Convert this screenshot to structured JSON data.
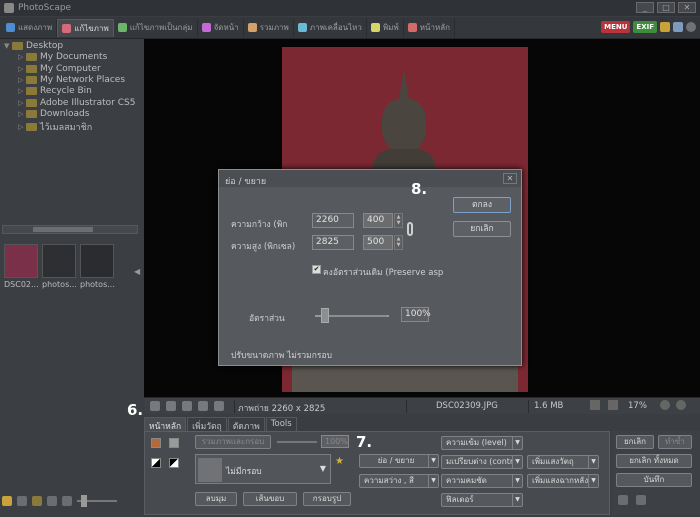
{
  "window": {
    "title": "PhotoScape",
    "buttons": [
      "_",
      "□",
      "✕"
    ]
  },
  "tabs": [
    {
      "label": "แสดงภาพ",
      "color": "#4d8ed3"
    },
    {
      "label": "แก้ไขภาพ",
      "color": "#d56a7a",
      "active": true
    },
    {
      "label": "แก้ไขภาพเป็นกลุ่ม",
      "color": "#6fb46d"
    },
    {
      "label": "จัดหน้า",
      "color": "#c46ad5"
    },
    {
      "label": "รวมภาพ",
      "color": "#d5a36a"
    },
    {
      "label": "ภาพเคลื่อนไหว",
      "color": "#6ab9d5"
    },
    {
      "label": "พิมพ์",
      "color": "#d5d56a"
    },
    {
      "label": "หน้าหลัก",
      "color": "#d56a6a"
    }
  ],
  "topright": {
    "menu": "MENU",
    "exif": "EXIF"
  },
  "tree": [
    {
      "label": "Desktop",
      "indent": 0
    },
    {
      "label": "My Documents",
      "indent": 1
    },
    {
      "label": "My Computer",
      "indent": 1
    },
    {
      "label": "My Network Places",
      "indent": 1
    },
    {
      "label": "Recycle Bin",
      "indent": 1
    },
    {
      "label": "Adobe Illustrator CS5",
      "indent": 1
    },
    {
      "label": "Downloads",
      "indent": 1
    },
    {
      "label": "ไว้เมลสมาชิก",
      "indent": 1
    }
  ],
  "thumbnails": [
    {
      "label": "DSC02..."
    },
    {
      "label": "photos..."
    },
    {
      "label": "photos..."
    }
  ],
  "dialog": {
    "title": "ย่อ / ขยาย",
    "close": "✕",
    "width_label": "ความกว้าง (พิก",
    "height_label": "ความสูง (พิกเซล)",
    "orig_width": "2260",
    "orig_height": "2825",
    "new_width": "400",
    "new_height": "500",
    "keep_ratio_label": "คงอัตราส่วนเดิม (Preserve asp",
    "ratio_label": "อัตราส่วน",
    "ratio_value": "100%",
    "note": "ปรับขนาดภาพ ไม่รวมกรอบ",
    "ok": "ตกลง",
    "cancel": "ยกเลิก"
  },
  "steps": {
    "s6": "6.",
    "s7": "7.",
    "s8": "8."
  },
  "status": {
    "dimensions": "ภาพถ่าย 2260 x 2825",
    "filename": "DSC02309.JPG",
    "filesize": "1.6 MB",
    "zoom": "17%"
  },
  "bottom_tabs": [
    "หน้าหลัก",
    "เพิ่มวัตถุ",
    "ตัดภาพ",
    "Tools"
  ],
  "bottom": {
    "combine": "รวมภาพและกรอบ",
    "combine_pct": "100%",
    "frame": "ไม่มีกรอบ",
    "round": "ลบมุม",
    "margin": "เส้นขอบ",
    "frame_line": "กรอบรูป",
    "resize": "ย่อ / ขยาย",
    "brightness": "ความสว่าง , สี",
    "level": "ความเข้ม (level)",
    "contrast": "มเปรียบต่าง (contr",
    "sharpen": "ความคมชัด",
    "filter": "ฟิลเตอร์",
    "add_obj": "เพิ่มแสงวัตถุ",
    "add_bg": "เพิ่มแสงฉากหลัง"
  },
  "right": {
    "cancel": "ยกเลิก",
    "redo": "ทำซ้ำ",
    "cancel_all": "ยกเลิก ทั้งหมด",
    "save": "บันทึก"
  }
}
